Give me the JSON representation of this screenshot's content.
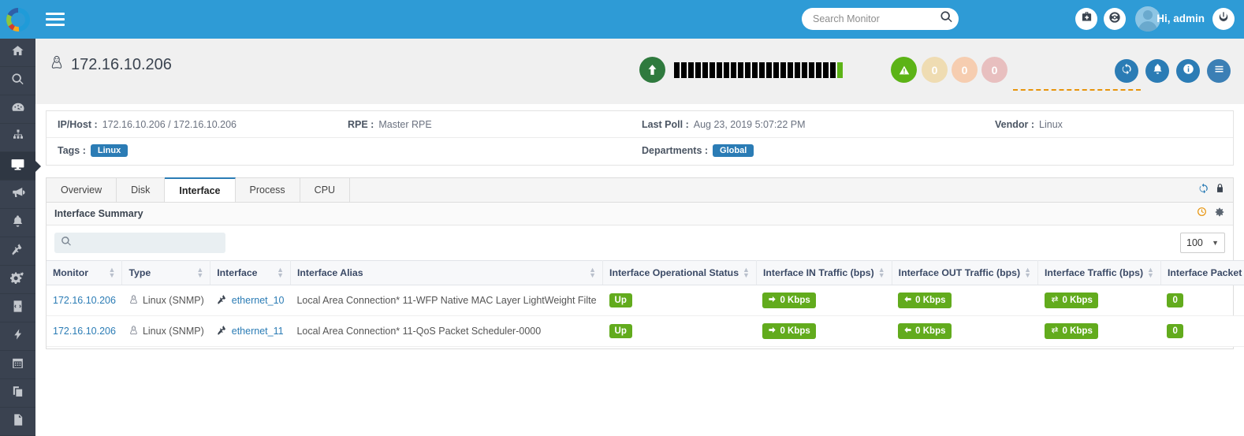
{
  "topbar": {
    "menu_icon": "hamburger-icon",
    "search_placeholder": "Search Monitor",
    "search_value": "",
    "search_icon": "search-icon",
    "toolkit_icon": "medical-kit-icon",
    "support_icon": "lifebuoy-icon",
    "avatar_icon": "user-avatar-icon",
    "greeting": "Hi, admin",
    "power_icon": "power-icon",
    "bg_color": "#2e9bd6"
  },
  "sidebar": {
    "logo": "opmanager-logo-icon",
    "items": [
      {
        "name": "home-icon",
        "active": false
      },
      {
        "name": "search-icon",
        "active": false
      },
      {
        "name": "dashboard-gauge-icon",
        "active": false
      },
      {
        "name": "network-sitemap-icon",
        "active": false
      },
      {
        "name": "monitor-screen-icon",
        "active": true
      },
      {
        "name": "megaphone-icon",
        "active": false
      },
      {
        "name": "bell-icon",
        "active": false
      },
      {
        "name": "plug-icon",
        "active": false
      },
      {
        "name": "gears-icon",
        "active": false
      },
      {
        "name": "code-file-icon",
        "active": false
      },
      {
        "name": "lightning-bolt-icon",
        "active": false
      },
      {
        "name": "calendar-icon",
        "active": false
      },
      {
        "name": "layers-copy-icon",
        "active": false
      },
      {
        "name": "document-icon",
        "active": false
      }
    ]
  },
  "page_header": {
    "device_icon": "linux-tux-icon",
    "title": "172.16.10.206",
    "availability_up_icon": "arrow-up-circle-icon",
    "availability_bars": 24,
    "availability_ok_index": 23,
    "severity_badges": [
      {
        "name": "alert-warning-badge",
        "label": "",
        "icon": "warning-triangle-icon",
        "color": "#5cb316",
        "text_color": "#ffffff"
      },
      {
        "name": "severity-count-warning",
        "label": "0",
        "icon": "",
        "color": "#efdcb2",
        "text_color": "#ffffff"
      },
      {
        "name": "severity-count-trouble",
        "label": "0",
        "icon": "",
        "color": "#f6cdb0",
        "text_color": "#ffffff"
      },
      {
        "name": "severity-count-critical",
        "label": "0",
        "icon": "",
        "color": "#e8bfbf",
        "text_color": "#ffffff"
      }
    ],
    "action_buttons": [
      {
        "name": "refresh-button",
        "icon": "refresh-icon"
      },
      {
        "name": "alarms-button",
        "icon": "bell-icon"
      },
      {
        "name": "info-button",
        "icon": "info-icon"
      },
      {
        "name": "more-menu-button",
        "icon": "hamburger-menu-icon"
      }
    ]
  },
  "info": {
    "ip_host_label": "IP/Host :",
    "ip_host_value": "172.16.10.206 / 172.16.10.206",
    "rpe_label": "RPE :",
    "rpe_value": "Master RPE",
    "last_poll_label": "Last Poll :",
    "last_poll_value": "Aug 23, 2019 5:07:22 PM",
    "vendor_label": "Vendor :",
    "vendor_value": "Linux",
    "tags_label": "Tags :",
    "tags_value": "Linux",
    "departments_label": "Departments :",
    "departments_value": "Global",
    "tag_color": "#2b7cb5"
  },
  "tabs": {
    "items": [
      {
        "label": "Overview",
        "active": false
      },
      {
        "label": "Disk",
        "active": false
      },
      {
        "label": "Interface",
        "active": true
      },
      {
        "label": "Process",
        "active": false
      },
      {
        "label": "CPU",
        "active": false
      }
    ],
    "tools": [
      {
        "name": "refresh-icon"
      },
      {
        "name": "lock-icon"
      }
    ]
  },
  "card": {
    "title": "Interface Summary",
    "head_tools": [
      {
        "name": "clock-icon"
      },
      {
        "name": "settings-gear-icon"
      }
    ],
    "search_placeholder": "",
    "search_value": "",
    "search_icon": "search-icon",
    "page_size_value": "100",
    "page_size_caret": "caret-down-icon"
  },
  "table": {
    "columns": [
      {
        "label": "Monitor",
        "sortable": true
      },
      {
        "label": "Type",
        "sortable": true
      },
      {
        "label": "Interface",
        "sortable": true
      },
      {
        "label": "Interface Alias",
        "sortable": true
      },
      {
        "label": "Interface Operational Status",
        "sortable": true
      },
      {
        "label": "Interface IN Traffic (bps)",
        "sortable": true
      },
      {
        "label": "Interface OUT Traffic (bps)",
        "sortable": true
      },
      {
        "label": "Interface Traffic (bps)",
        "sortable": true
      },
      {
        "label": "Interface Packet Errors",
        "sortable": true
      }
    ],
    "rows": [
      {
        "monitor": "172.16.10.206",
        "type_icon": "linux-tux-icon",
        "type": "Linux (SNMP)",
        "interface_icon": "plug-icon",
        "interface": "ethernet_10",
        "alias": "Local Area Connection* 11-WFP Native MAC Layer LightWeight Filte",
        "status": "Up",
        "in_traffic": "0 Kbps",
        "in_icon": "arrow-right-icon",
        "out_traffic": "0 Kbps",
        "out_icon": "arrow-left-icon",
        "total_traffic": "0 Kbps",
        "total_icon": "arrows-exchange-icon",
        "packet_errors": "0"
      },
      {
        "monitor": "172.16.10.206",
        "type_icon": "linux-tux-icon",
        "type": "Linux (SNMP)",
        "interface_icon": "plug-icon",
        "interface": "ethernet_11",
        "alias": "Local Area Connection* 11-QoS Packet Scheduler-0000",
        "status": "Up",
        "in_traffic": "0 Kbps",
        "in_icon": "arrow-right-icon",
        "out_traffic": "0 Kbps",
        "out_icon": "arrow-left-icon",
        "total_traffic": "0 Kbps",
        "total_icon": "arrows-exchange-icon",
        "packet_errors": "0"
      }
    ],
    "badge_color": "#62ab1d"
  }
}
